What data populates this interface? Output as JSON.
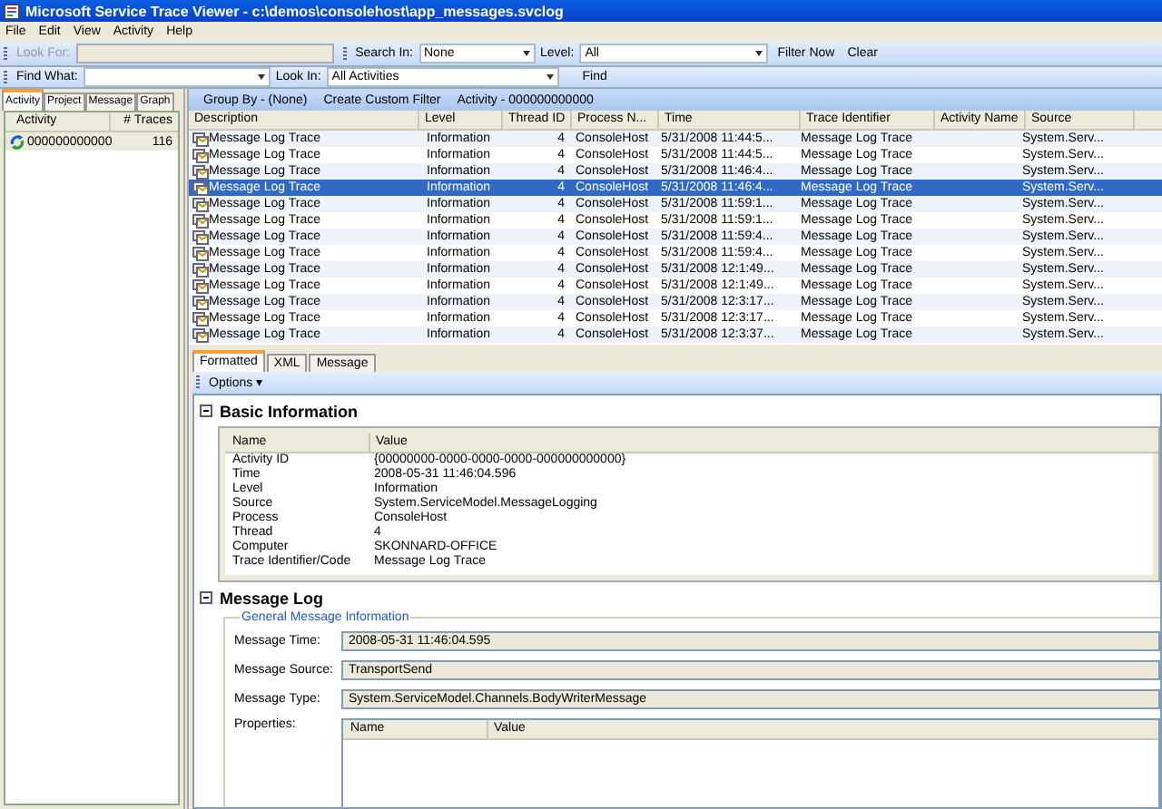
{
  "window": {
    "title": "Microsoft Service Trace Viewer - c:\\demos\\consolehost\\app_messages.svclog"
  },
  "menu": [
    "File",
    "Edit",
    "View",
    "Activity",
    "Help"
  ],
  "toolbar": {
    "look_for_label": "Look For:",
    "search_in_label": "Search In:",
    "search_in_value": "None",
    "level_label": "Level:",
    "level_value": "All",
    "filter_now": "Filter Now",
    "clear": "Clear"
  },
  "find_bar": {
    "find_what_label": "Find What:",
    "look_in_label": "Look In:",
    "look_in_value": "All Activities",
    "find": "Find"
  },
  "left_tabs": [
    {
      "label": "Activity",
      "selected": true
    },
    {
      "label": "Project",
      "selected": false
    },
    {
      "label": "Message",
      "selected": false
    },
    {
      "label": "Graph",
      "selected": false
    }
  ],
  "activities": {
    "columns": [
      "Activity",
      "# Traces"
    ],
    "rows": [
      {
        "name": "000000000000",
        "traces": "116",
        "selected": true
      }
    ]
  },
  "group_bar": {
    "group_by": "Group By - (None)",
    "custom_filter": "Create Custom Filter",
    "activity": "Activity - 000000000000"
  },
  "traces": {
    "columns": [
      "Description",
      "Level",
      "Thread ID",
      "Process N...",
      "Time",
      "Trace Identifier",
      "Activity Name",
      "Source"
    ],
    "rows": [
      {
        "description": "Message Log Trace",
        "level": "Information",
        "thread": "4",
        "process": "ConsoleHost",
        "time": "5/31/2008  11:44:5...",
        "trace_id": "Message Log Trace",
        "source": "System.Serv...",
        "selected": false
      },
      {
        "description": "Message Log Trace",
        "level": "Information",
        "thread": "4",
        "process": "ConsoleHost",
        "time": "5/31/2008  11:44:5...",
        "trace_id": "Message Log Trace",
        "source": "System.Serv...",
        "selected": false
      },
      {
        "description": "Message Log Trace",
        "level": "Information",
        "thread": "4",
        "process": "ConsoleHost",
        "time": "5/31/2008  11:46:4...",
        "trace_id": "Message Log Trace",
        "source": "System.Serv...",
        "selected": false
      },
      {
        "description": "Message Log Trace",
        "level": "Information",
        "thread": "4",
        "process": "ConsoleHost",
        "time": "5/31/2008  11:46:4...",
        "trace_id": "Message Log Trace",
        "source": "System.Serv...",
        "selected": true
      },
      {
        "description": "Message Log Trace",
        "level": "Information",
        "thread": "4",
        "process": "ConsoleHost",
        "time": "5/31/2008  11:59:1...",
        "trace_id": "Message Log Trace",
        "source": "System.Serv...",
        "selected": false
      },
      {
        "description": "Message Log Trace",
        "level": "Information",
        "thread": "4",
        "process": "ConsoleHost",
        "time": "5/31/2008  11:59:1...",
        "trace_id": "Message Log Trace",
        "source": "System.Serv...",
        "selected": false
      },
      {
        "description": "Message Log Trace",
        "level": "Information",
        "thread": "4",
        "process": "ConsoleHost",
        "time": "5/31/2008  11:59:4...",
        "trace_id": "Message Log Trace",
        "source": "System.Serv...",
        "selected": false
      },
      {
        "description": "Message Log Trace",
        "level": "Information",
        "thread": "4",
        "process": "ConsoleHost",
        "time": "5/31/2008  11:59:4...",
        "trace_id": "Message Log Trace",
        "source": "System.Serv...",
        "selected": false
      },
      {
        "description": "Message Log Trace",
        "level": "Information",
        "thread": "4",
        "process": "ConsoleHost",
        "time": "5/31/2008  12:1:49...",
        "trace_id": "Message Log Trace",
        "source": "System.Serv...",
        "selected": false
      },
      {
        "description": "Message Log Trace",
        "level": "Information",
        "thread": "4",
        "process": "ConsoleHost",
        "time": "5/31/2008  12:1:49...",
        "trace_id": "Message Log Trace",
        "source": "System.Serv...",
        "selected": false
      },
      {
        "description": "Message Log Trace",
        "level": "Information",
        "thread": "4",
        "process": "ConsoleHost",
        "time": "5/31/2008  12:3:17...",
        "trace_id": "Message Log Trace",
        "source": "System.Serv...",
        "selected": false
      },
      {
        "description": "Message Log Trace",
        "level": "Information",
        "thread": "4",
        "process": "ConsoleHost",
        "time": "5/31/2008  12:3:17...",
        "trace_id": "Message Log Trace",
        "source": "System.Serv...",
        "selected": false
      },
      {
        "description": "Message Log Trace",
        "level": "Information",
        "thread": "4",
        "process": "ConsoleHost",
        "time": "5/31/2008  12:3:37...",
        "trace_id": "Message Log Trace",
        "source": "System.Serv...",
        "selected": false
      }
    ]
  },
  "detail_tabs": [
    {
      "label": "Formatted",
      "selected": true
    },
    {
      "label": "XML",
      "selected": false
    },
    {
      "label": "Message",
      "selected": false
    }
  ],
  "options": {
    "label": "Options",
    "caret": "▾"
  },
  "basic_information": {
    "title": "Basic Information",
    "columns": [
      "Name",
      "Value"
    ],
    "rows": [
      {
        "name": "Activity ID",
        "value": "{00000000-0000-0000-0000-000000000000}"
      },
      {
        "name": "Time",
        "value": "2008-05-31 11:46:04.596"
      },
      {
        "name": "Level",
        "value": "Information"
      },
      {
        "name": "Source",
        "value": "System.ServiceModel.MessageLogging"
      },
      {
        "name": "Process",
        "value": "ConsoleHost"
      },
      {
        "name": "Thread",
        "value": "4"
      },
      {
        "name": "Computer",
        "value": "SKONNARD-OFFICE"
      },
      {
        "name": "Trace Identifier/Code",
        "value": "Message Log Trace"
      }
    ]
  },
  "message_log": {
    "title": "Message Log",
    "group": "General Message Information",
    "fields": [
      {
        "label": "Message Time:",
        "value": "2008-05-31 11:46:04.595"
      },
      {
        "label": "Message Source:",
        "value": "TransportSend"
      },
      {
        "label": "Message Type:",
        "value": "System.ServiceModel.Channels.BodyWriterMessage"
      }
    ],
    "properties_label": "Properties:",
    "properties_columns": [
      "Name",
      "Value"
    ]
  }
}
